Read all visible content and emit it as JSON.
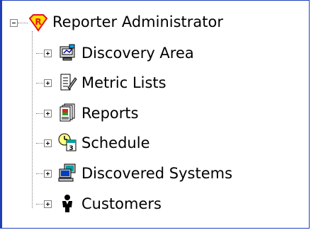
{
  "tree": {
    "root": {
      "label": "Reporter Administrator",
      "icon": "reporter-logo-icon",
      "expanded": true
    },
    "children": [
      {
        "label": "Discovery Area",
        "icon": "discovery-area-icon",
        "expanded": false
      },
      {
        "label": "Metric Lists",
        "icon": "metric-list-icon",
        "expanded": false
      },
      {
        "label": "Reports",
        "icon": "reports-icon",
        "expanded": false
      },
      {
        "label": "Schedule",
        "icon": "schedule-icon",
        "expanded": false
      },
      {
        "label": "Discovered Systems",
        "icon": "discovered-systems-icon",
        "expanded": false
      },
      {
        "label": "Customers",
        "icon": "customers-icon",
        "expanded": false
      }
    ]
  },
  "colors": {
    "border": "#1f3fb8",
    "connector": "#808080",
    "logo_red": "#e8101a",
    "logo_yellow": "#ffe000"
  }
}
